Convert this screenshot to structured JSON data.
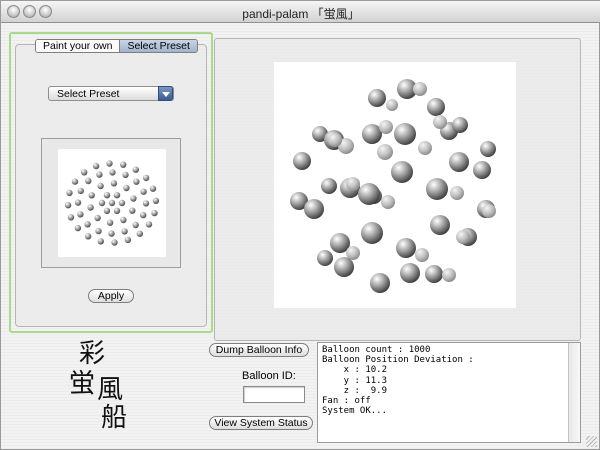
{
  "window": {
    "title": "pandi-palam 「蛍風」",
    "controls": [
      "close",
      "minimize",
      "zoom"
    ]
  },
  "left_panel": {
    "tabs": [
      {
        "label": "Paint your own",
        "active": false
      },
      {
        "label": "Select Preset",
        "active": true
      }
    ],
    "preset_select": {
      "selected": "Select Preset"
    },
    "apply_label": "Apply"
  },
  "bottom": {
    "logo_text": "彩蛍風船",
    "dump_label": "Dump Balloon Info",
    "balloon_id_label": "Balloon ID:",
    "balloon_id_value": "",
    "status_label": "View System Status"
  },
  "console": {
    "lines": [
      "Balloon count : 1000",
      "Balloon Position Deviation :",
      "    x : 10.2",
      "    y : 11.3",
      "    z :  9.9",
      "Fan : off",
      "",
      "System OK..."
    ]
  },
  "colors": {
    "selection_outline": "#a8d98d",
    "tab_active": "#9fb1cd",
    "select_arrow": "#3e5b91",
    "balloon": "#8a8a8a"
  }
}
